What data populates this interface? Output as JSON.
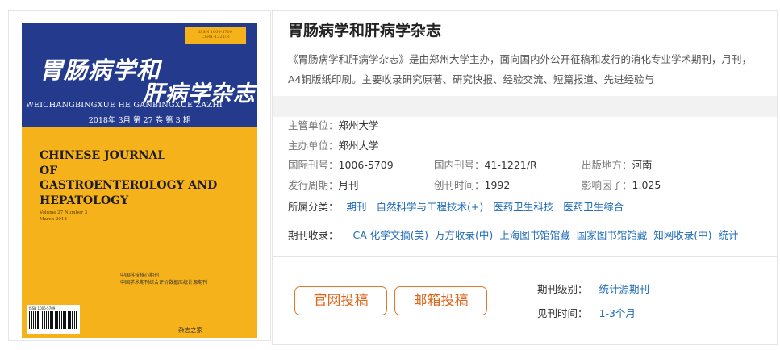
{
  "cover": {
    "issn_box": "ISSN 1006-5709\nCN41-1221/R",
    "title_cn_line1": "胃肠病学和",
    "title_cn_line2": "肝病学杂志",
    "pinyin": "WEICHANGBINGXUE HE GANBINGXUE ZAZHI",
    "issue_date": "2018年 3月 第 27 卷 第 3 期",
    "title_en": "CHINESE JOURNAL\nOF\nGASTROENTEROLOGY AND\nHEPATOLOGY",
    "volume": "Volume 27 Number 3\nMarch 2018",
    "core_text": "中国科技核心期刊\n中国学术期刊综合评价数据库统计源期刊",
    "barcode_text": "ISSN 1006-5709",
    "publisher_logo": "杂志之家",
    "colors": {
      "band": "#243a8c",
      "background": "#f6b21a"
    }
  },
  "journal": {
    "title": "胃肠病学和肝病学杂志",
    "description": "《胃肠病学和肝病学杂志》是由郑州大学主办，面向国内外公开征稿和发行的消化专业学术期刊，月刊，A4铜版纸印刷。主要收录研究原著、研究快报、经验交流、短篇报道、先进经验与"
  },
  "meta": {
    "supervisor_label": "主管单位：",
    "supervisor": "郑州大学",
    "sponsor_label": "主办单位：",
    "sponsor": "郑州大学",
    "issn_label": "国际刊号：",
    "issn": "1006-5709",
    "cn_label": "国内刊号：",
    "cn": "41-1221/R",
    "location_label": "出版地方：",
    "location": "河南",
    "frequency_label": "发行周期：",
    "frequency": "月刊",
    "founded_label": "创刊时间：",
    "founded": "1992",
    "impact_label": "影响因子：",
    "impact": "1.025"
  },
  "categories": {
    "label": "所属分类：",
    "items": [
      "期刊",
      "自然科学与工程技术(+)",
      "医药卫生科技",
      "医药卫生综合"
    ]
  },
  "databases": {
    "label": "期刊收录：",
    "items": [
      "CA 化学文摘(美)",
      "万方收录(中)",
      "上海图书馆馆藏",
      "国家图书馆馆藏",
      "知网收录(中)",
      "统计"
    ]
  },
  "actions": {
    "site_submit": "官网投稿",
    "email_submit": "邮箱投稿"
  },
  "side_info": {
    "level_label": "期刊级别：",
    "level": "统计源期刊",
    "time_label": "见刊时间：",
    "time": "1-3个月"
  },
  "colors": {
    "link": "#1e6bb8",
    "button": "#e0641a"
  }
}
